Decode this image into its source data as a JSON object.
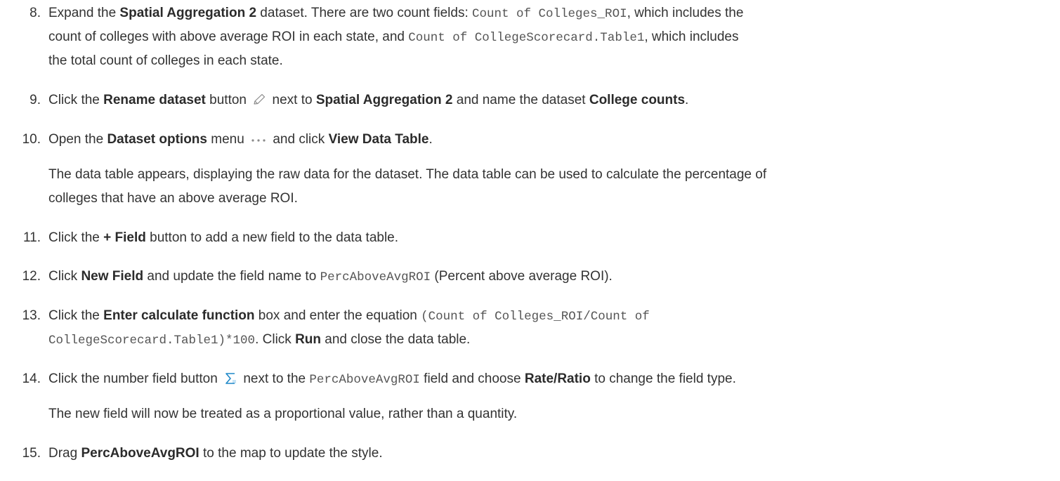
{
  "steps": [
    {
      "number": "8.",
      "lines": [
        [
          "Expand the ",
          {
            "b": "Spatial Aggregation 2"
          },
          " dataset. There are two count fields: ",
          {
            "c": "Count of Colleges_ROI"
          },
          ", which includes the"
        ],
        [
          "count of colleges with above average ROI in each state, and ",
          {
            "c": "Count of CollegeScorecard.Table1"
          },
          ", which includes"
        ],
        [
          "the total count of colleges in each state."
        ]
      ]
    },
    {
      "number": "9.",
      "lines": [
        [
          "Click the ",
          {
            "b": "Rename dataset"
          },
          " button ",
          {
            "icon": "pencil-icon"
          },
          " next to ",
          {
            "b": "Spatial Aggregation 2"
          },
          " and name the dataset ",
          {
            "b": "College counts"
          },
          "."
        ]
      ]
    },
    {
      "number": "10.",
      "lines": [
        [
          "Open the ",
          {
            "b": "Dataset options"
          },
          " menu ",
          {
            "icon": "more-options-icon"
          },
          " and click ",
          {
            "b": "View Data Table"
          },
          "."
        ]
      ],
      "note": [
        "The data table appears, displaying the raw data for the dataset. The data table can be used to calculate the percentage of",
        "colleges that have an above average ROI."
      ]
    },
    {
      "number": "11.",
      "lines": [
        [
          "Click the ",
          {
            "b": "+ Field"
          },
          " button to add a new field to the data table."
        ]
      ]
    },
    {
      "number": "12.",
      "lines": [
        [
          "Click ",
          {
            "b": "New Field"
          },
          " and update the field name to ",
          {
            "c": "PercAboveAvgROI"
          },
          " (Percent above average ROI)."
        ]
      ]
    },
    {
      "number": "13.",
      "lines": [
        [
          "Click the ",
          {
            "b": "Enter calculate function"
          },
          " box and enter the equation ",
          {
            "c": "(Count of Colleges_ROI/Count of"
          }
        ],
        [
          {
            "c": "CollegeScorecard.Table1)*100"
          },
          ". Click ",
          {
            "b": "Run"
          },
          " and close the data table."
        ]
      ]
    },
    {
      "number": "14.",
      "lines": [
        [
          "Click the number field button ",
          {
            "icon": "sigma-icon"
          },
          " next to the ",
          {
            "c": "PercAboveAvgROI"
          },
          " field and choose ",
          {
            "b": "Rate/Ratio"
          },
          " to change the field type."
        ]
      ],
      "note": [
        "The new field will now be treated as a proportional value, rather than a quantity."
      ]
    },
    {
      "number": "15.",
      "lines": [
        [
          "Drag ",
          {
            "b": "PercAboveAvgROI"
          },
          " to the map to update the style."
        ]
      ]
    }
  ],
  "colors": {
    "text": "#333333",
    "code": "#555555",
    "icon": "#8a8a8a",
    "sigma": "#1e88c8"
  }
}
